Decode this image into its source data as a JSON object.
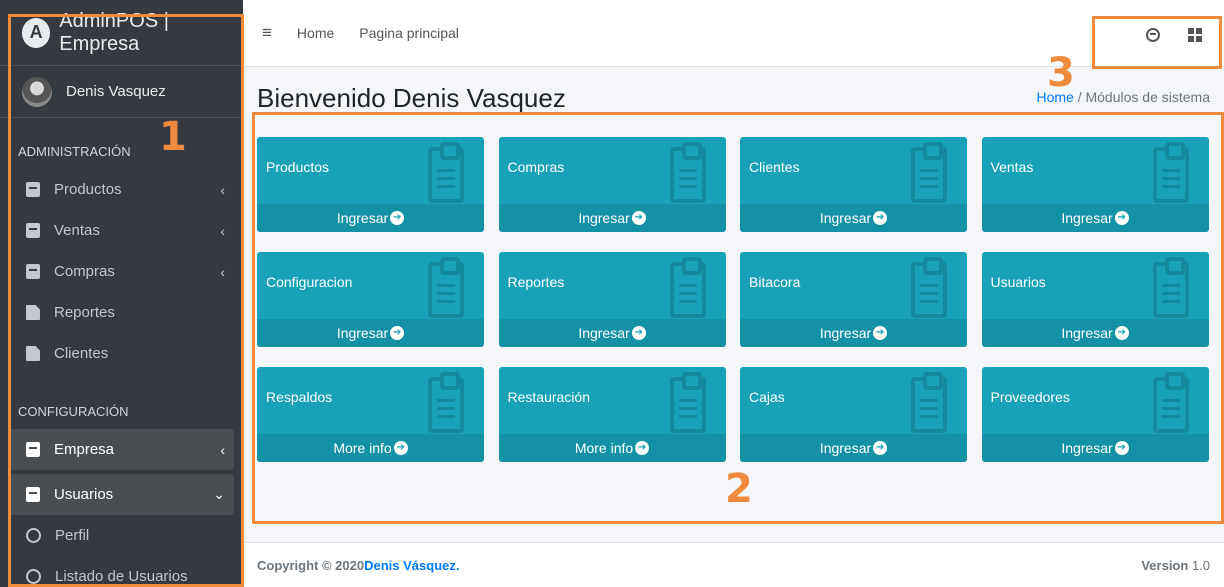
{
  "sidebar": {
    "brand": "AdminPOS | Empresa",
    "brand_letter": "A",
    "user_name": "Denis Vasquez",
    "sections": [
      {
        "header": "ADMINISTRACIÓN",
        "items": [
          {
            "label": "Productos",
            "icon": "book-icon",
            "chevron": "‹"
          },
          {
            "label": "Ventas",
            "icon": "book-icon",
            "chevron": "‹"
          },
          {
            "label": "Compras",
            "icon": "book-icon",
            "chevron": "‹"
          },
          {
            "label": "Reportes",
            "icon": "file-icon"
          },
          {
            "label": "Clientes",
            "icon": "file-icon"
          }
        ]
      },
      {
        "header": "CONFIGURACIÓN",
        "items": [
          {
            "label": "Empresa",
            "icon": "book-icon",
            "chevron": "‹"
          },
          {
            "label": "Usuarios",
            "icon": "book-icon",
            "chevron": "⌄"
          },
          {
            "label": "Perfil",
            "icon": "circle-icon"
          },
          {
            "label": "Listado de Usuarios",
            "icon": "circle-icon"
          }
        ]
      }
    ]
  },
  "topbar": {
    "menu_icon": "≡",
    "links": [
      "Home",
      "Pagina principal"
    ]
  },
  "content": {
    "title": "Bienvenido Denis Vasquez",
    "breadcrumb_home": "Home",
    "breadcrumb_sep": "/",
    "breadcrumb_current": "Módulos de sistema",
    "tiles": [
      {
        "label": "Productos",
        "action": "Ingresar"
      },
      {
        "label": "Compras",
        "action": "Ingresar"
      },
      {
        "label": "Clientes",
        "action": "Ingresar"
      },
      {
        "label": "Ventas",
        "action": "Ingresar"
      },
      {
        "label": "Configuracion",
        "action": "Ingresar"
      },
      {
        "label": "Reportes",
        "action": "Ingresar"
      },
      {
        "label": "Bitacora",
        "action": "Ingresar"
      },
      {
        "label": "Usuarios",
        "action": "Ingresar"
      },
      {
        "label": "Respaldos",
        "action": "More info "
      },
      {
        "label": "Restauración",
        "action": "More info "
      },
      {
        "label": "Cajas",
        "action": "Ingresar "
      },
      {
        "label": "Proveedores",
        "action": "Ingresar "
      }
    ],
    "arrow_glyph": "➔"
  },
  "footer": {
    "copyright": "Copyright © 2020 ",
    "author": "Denis Vásquez.",
    "version_label": "Version",
    "version_number": " 1.0"
  },
  "annotations": {
    "n1": "1",
    "n2": "2",
    "n3": "3"
  },
  "colors": {
    "sidebar_bg": "#343a40",
    "tile_bg": "#17a2b8",
    "link": "#007bff",
    "annotation": "#f08a3c"
  }
}
